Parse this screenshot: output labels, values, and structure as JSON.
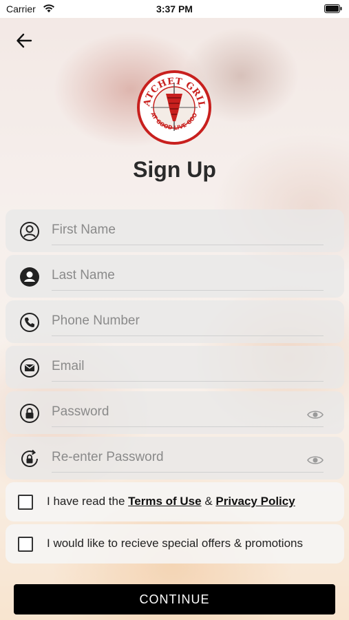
{
  "statusbar": {
    "carrier": "Carrier",
    "time": "3:37 PM"
  },
  "logo": {
    "top_text": "DATCHET GRILL",
    "bottom_text": "EAT GOOD LIVE GOOD"
  },
  "page": {
    "title": "Sign Up"
  },
  "form": {
    "first_name_placeholder": "First Name",
    "last_name_placeholder": "Last Name",
    "phone_placeholder": "Phone Number",
    "email_placeholder": "Email",
    "password_placeholder": "Password",
    "reenter_password_placeholder": "Re-enter Password"
  },
  "consent": {
    "terms_prefix": "I have read the ",
    "terms_link": "Terms of Use",
    "amp": " & ",
    "privacy_link": "Privacy Policy",
    "offers_label": "I would like to recieve special offers & promotions"
  },
  "actions": {
    "continue_label": "CONTINUE"
  },
  "colors": {
    "button_bg": "#000000",
    "logo_red": "#c8201e"
  }
}
